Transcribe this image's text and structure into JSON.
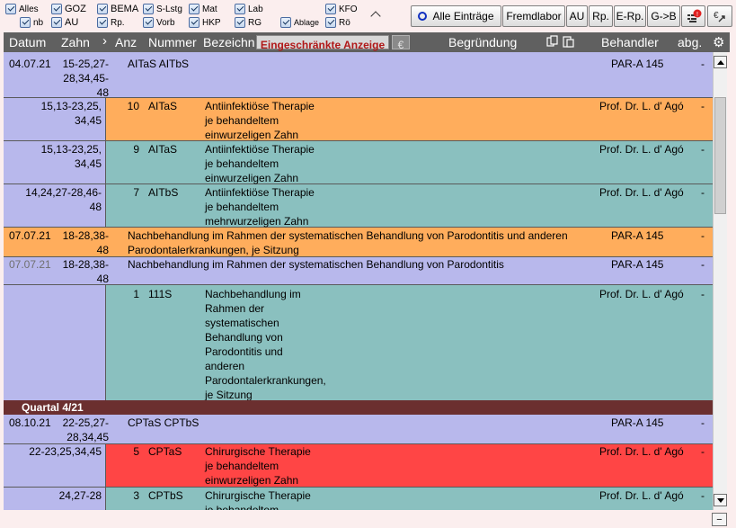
{
  "filters": [
    {
      "label": "Alles",
      "checked": true
    },
    {
      "label": "nb",
      "checked": true
    },
    {
      "label": "GOZ",
      "checked": true
    },
    {
      "label": "AU",
      "checked": true
    },
    {
      "label": "BEMA",
      "checked": true
    },
    {
      "label": "Rp.",
      "checked": true
    },
    {
      "label": "S-Lstg",
      "checked": true
    },
    {
      "label": "Vorb",
      "checked": true
    },
    {
      "label": "Mat",
      "checked": true
    },
    {
      "label": "HKP",
      "checked": true
    },
    {
      "label": "Lab",
      "checked": true
    },
    {
      "label": "RG",
      "checked": true
    },
    {
      "label": "KFO",
      "checked": true
    },
    {
      "label": "Ablage",
      "checked": true
    },
    {
      "label": "Rö",
      "checked": true
    }
  ],
  "toolbar": {
    "alle": "Alle Einträge",
    "fremdlabor": "Fremdlabor",
    "au": "AU",
    "rp": "Rp.",
    "erp": "E-Rp.",
    "gb": "G->B",
    "alert_badge": "!",
    "phone_icon": "phone-icon"
  },
  "header": {
    "datum": "Datum",
    "zahn": "Zahn",
    "anz": "Anz",
    "nummer": "Nummer",
    "bezeichnung": "Bezeichn",
    "eingeschraenkt": "Eingeschränkte Anzeige",
    "euro": "€",
    "begruendung": "Begründung",
    "behandler": "Behandler",
    "abg": "abg."
  },
  "rows": [
    {
      "kind": "main",
      "date": "04.07.21",
      "teeth": "15-25,27-\n28,34,45-\n48",
      "text": "AITaS AITbS",
      "behandler": "PAR-A 145",
      "abg": "-"
    },
    {
      "kind": "sub",
      "color": "orange",
      "teeth": "15,13-23,25,\n34,45",
      "anz": "10",
      "nr": "AITaS",
      "text": "Antiinfektiöse Therapie\nje behandeltem\neinwurzeligen Zahn",
      "behandler": "Prof. Dr. L. d' Agó",
      "abg": "-"
    },
    {
      "kind": "sub",
      "color": "teal",
      "teeth": "15,13-23,25,\n34,45",
      "anz": "9",
      "nr": "AITaS",
      "text": "Antiinfektiöse Therapie\nje behandeltem\neinwurzeligen Zahn",
      "behandler": "Prof. Dr. L. d' Agó",
      "abg": "-"
    },
    {
      "kind": "sub",
      "color": "teal",
      "teeth": "14,24,27-28,46-\n48",
      "anz": "7",
      "nr": "AITbS",
      "text": "Antiinfektiöse Therapie\nje behandeltem\nmehrwurzeligen Zahn",
      "behandler": "Prof. Dr. L. d' Agó",
      "abg": "-"
    },
    {
      "kind": "main-or",
      "date": "07.07.21",
      "teeth": "18-28,38-\n48",
      "text": "Nachbehandlung im Rahmen der systematischen Behandlung von Parodontitis und anderen\nParodontalerkrankungen, je Sitzung",
      "behandler": "PAR-A 145",
      "abg": "-"
    },
    {
      "kind": "main",
      "date": "07.07.21",
      "teeth": "18-28,38-\n48",
      "text": "Nachbehandlung im Rahmen der systematischen Behandlung von Parodontitis",
      "behandler": "PAR-A 145",
      "abg": "-"
    },
    {
      "kind": "sub",
      "color": "teal",
      "teeth": "",
      "anz": "1",
      "nr": "111S",
      "text": "Nachbehandlung im\nRahmen der\nsystematischen\nBehandlung von\nParodontitis und\nanderen\nParodontalerkrankungen,\nje Sitzung",
      "behandler": "Prof. Dr. L. d' Agó",
      "abg": "-"
    },
    {
      "kind": "quarter",
      "label": "Quartal 4/21"
    },
    {
      "kind": "main",
      "date": "08.10.21",
      "teeth": "22-25,27-\n28,34,45",
      "text": "CPTaS CPTbS",
      "behandler": "PAR-A 145",
      "abg": "-"
    },
    {
      "kind": "sub",
      "color": "red",
      "teeth": "22-23,25,34,45",
      "anz": "5",
      "nr": "CPTaS",
      "text": "Chirurgische Therapie\nje behandeltem\neinwurzeligen Zahn",
      "behandler": "Prof. Dr. L. d' Agó",
      "abg": "-"
    },
    {
      "kind": "sub",
      "color": "teal",
      "teeth": "24,27-28",
      "anz": "3",
      "nr": "CPTbS",
      "text": "Chirurgische Therapie\nje behandeltem",
      "behandler": "Prof. Dr. L. d' Agó",
      "abg": "-"
    }
  ]
}
